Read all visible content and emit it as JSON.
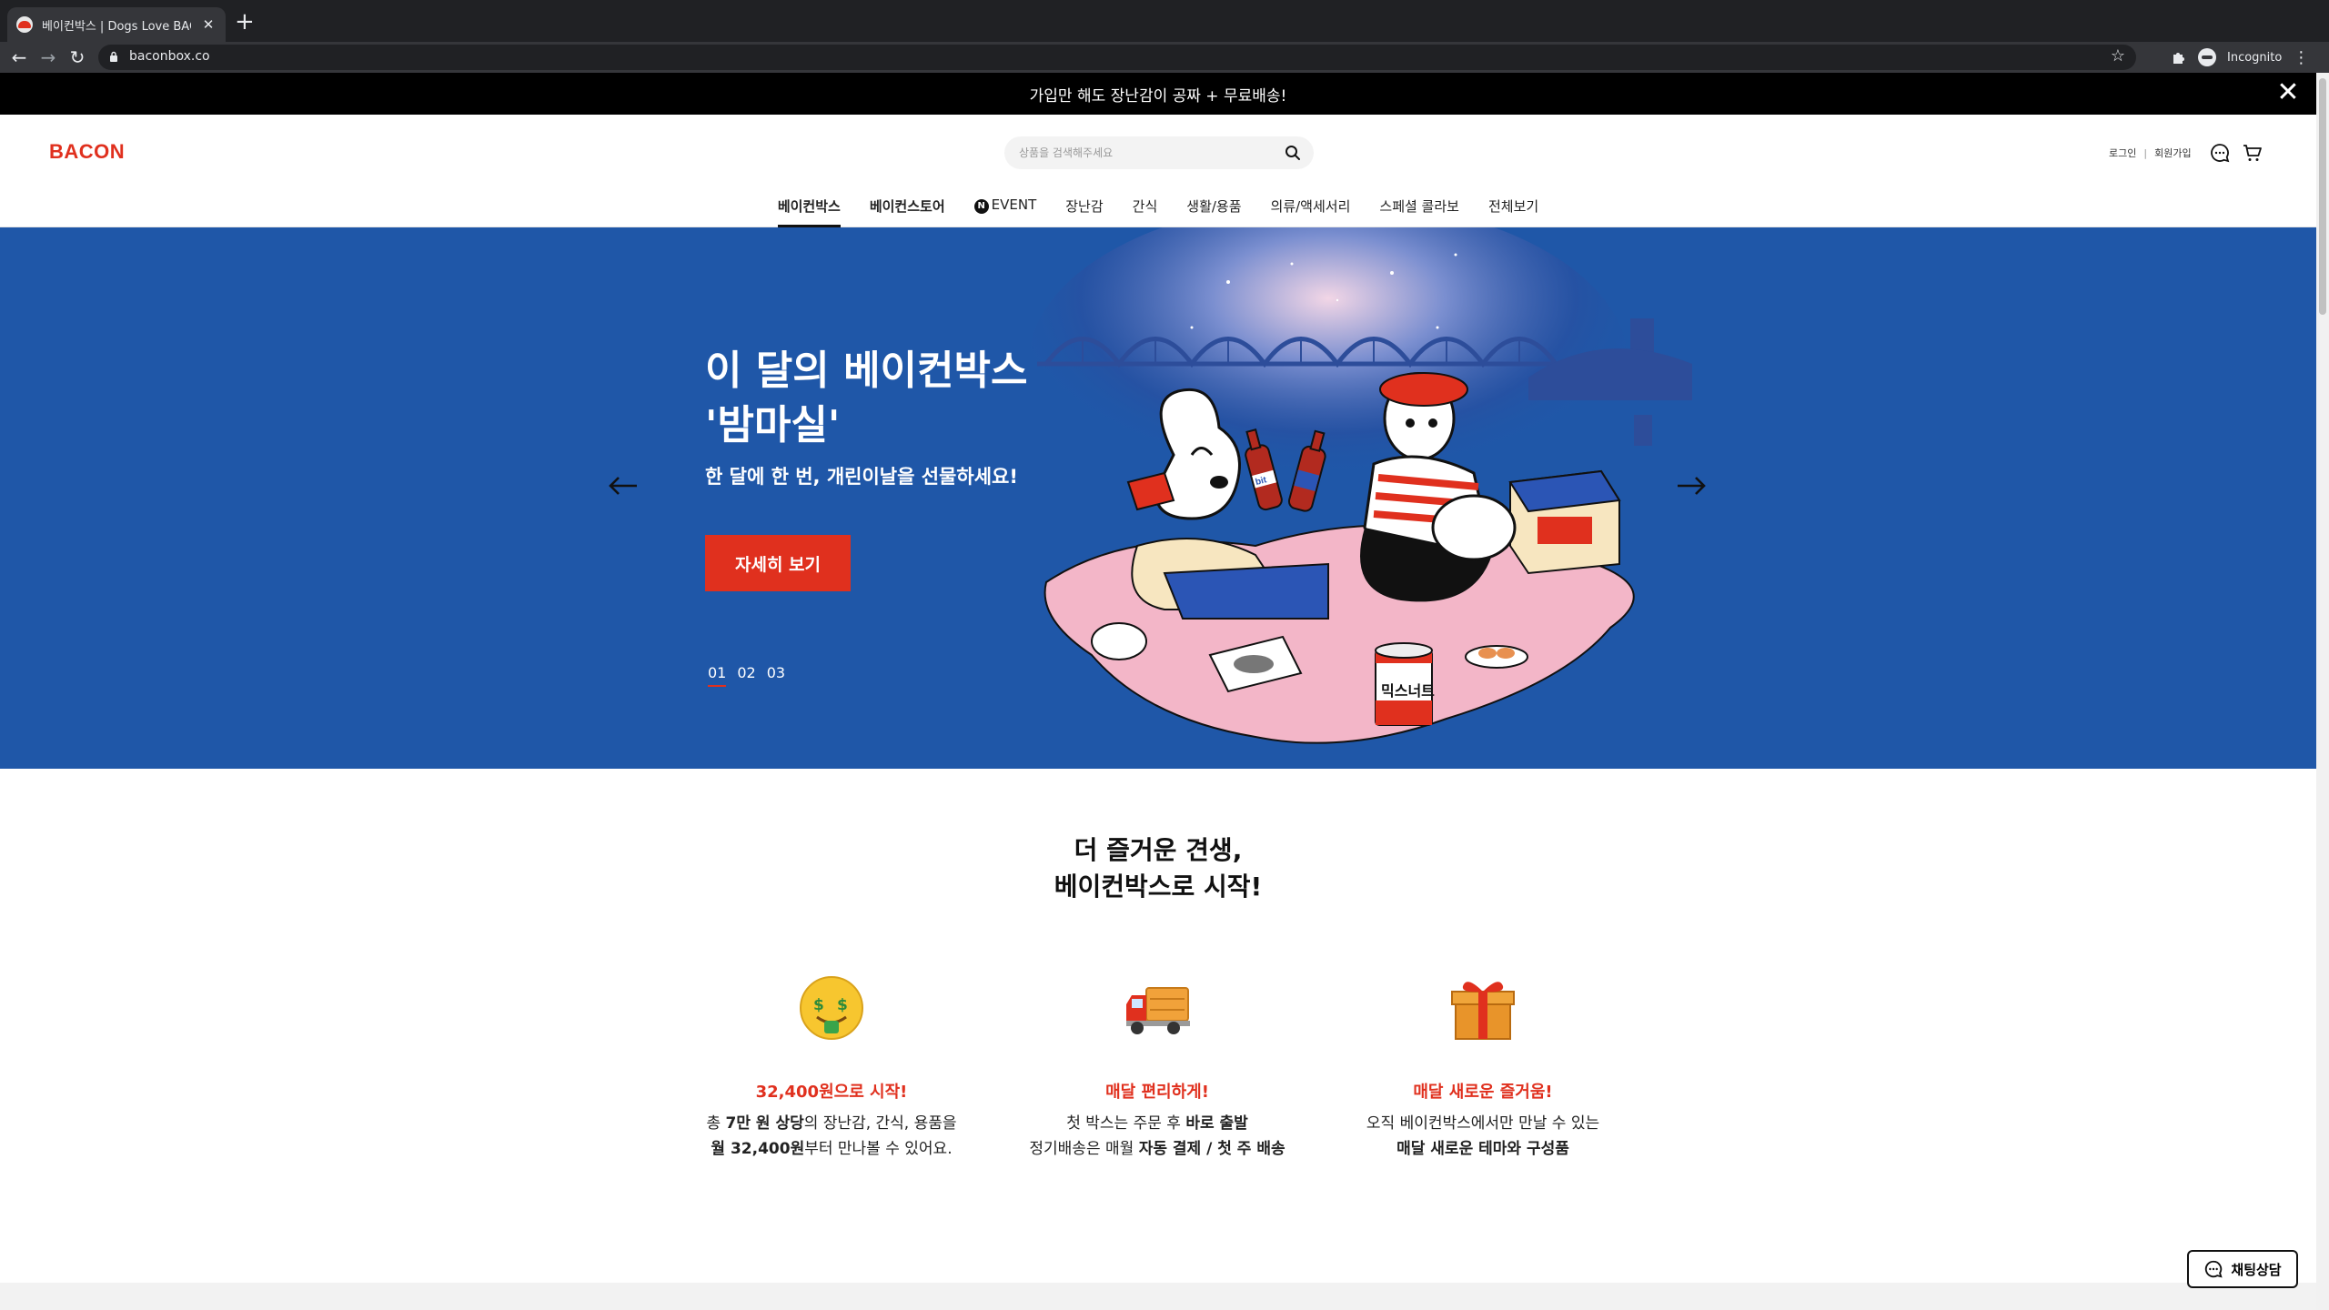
{
  "browser": {
    "tab_title": "베이컨박스 | Dogs Love BACON!",
    "url": "baconbox.co",
    "profile_label": "Incognito"
  },
  "promo": {
    "text": "가입만 해도 장난감이 공짜 + 무료배송!"
  },
  "header": {
    "logo": "BACON",
    "search_placeholder": "상품을 검색해주세요",
    "login": "로그인",
    "separator": "|",
    "signup": "회원가입"
  },
  "nav": {
    "items": [
      {
        "label": "베이컨박스"
      },
      {
        "label": "베이컨스토어"
      },
      {
        "label": "EVENT",
        "badge": "N"
      },
      {
        "label": "장난감"
      },
      {
        "label": "간식"
      },
      {
        "label": "생활/용품"
      },
      {
        "label": "의류/액세서리"
      },
      {
        "label": "스페셜 콜라보"
      },
      {
        "label": "전체보기"
      }
    ]
  },
  "hero": {
    "title_line1": "이 달의 베이컨박스",
    "title_line2": "'밤마실'",
    "subtitle": "한 달에 한 번, 개린이날을 선물하세요!",
    "cta": "자세히 보기",
    "pages": [
      "01",
      "02",
      "03"
    ],
    "current_page": "01",
    "bottle_label": "bit",
    "can_label": "믹스너트",
    "background_color": "#1f57a8"
  },
  "intro": {
    "line1": "더 즐거운 견생,",
    "line2": "베이컨박스로 시작!"
  },
  "features": [
    {
      "icon": "money-mouth-face-icon",
      "title": "32,400원으로 시작!",
      "line1": [
        {
          "t": "총 "
        },
        {
          "t": "7만 원 상당",
          "b": true
        },
        {
          "t": "의 장난감, 간식, 용품을"
        }
      ],
      "line2": [
        {
          "t": "월 32,400원",
          "b": true
        },
        {
          "t": "부터 만나볼 수 있어요."
        }
      ]
    },
    {
      "icon": "delivery-truck-icon",
      "title": "매달 편리하게!",
      "line1": [
        {
          "t": "첫 박스는 주문 후 "
        },
        {
          "t": "바로 출발",
          "b": true
        }
      ],
      "line2": [
        {
          "t": "정기배송은 매월 "
        },
        {
          "t": "자동 결제 / 첫 주 배송",
          "b": true
        }
      ]
    },
    {
      "icon": "wrapped-gift-icon",
      "title": "매달 새로운 즐거움!",
      "line1": [
        {
          "t": "오직 베이컨박스에서만 만날 수 있는"
        }
      ],
      "line2": [
        {
          "t": "매달 새로운 테마와 구성품",
          "b": true
        }
      ]
    }
  ],
  "chat": {
    "label": "채팅상담"
  },
  "colors": {
    "accent": "#e0301e",
    "hero_blue": "#1f57a8"
  }
}
